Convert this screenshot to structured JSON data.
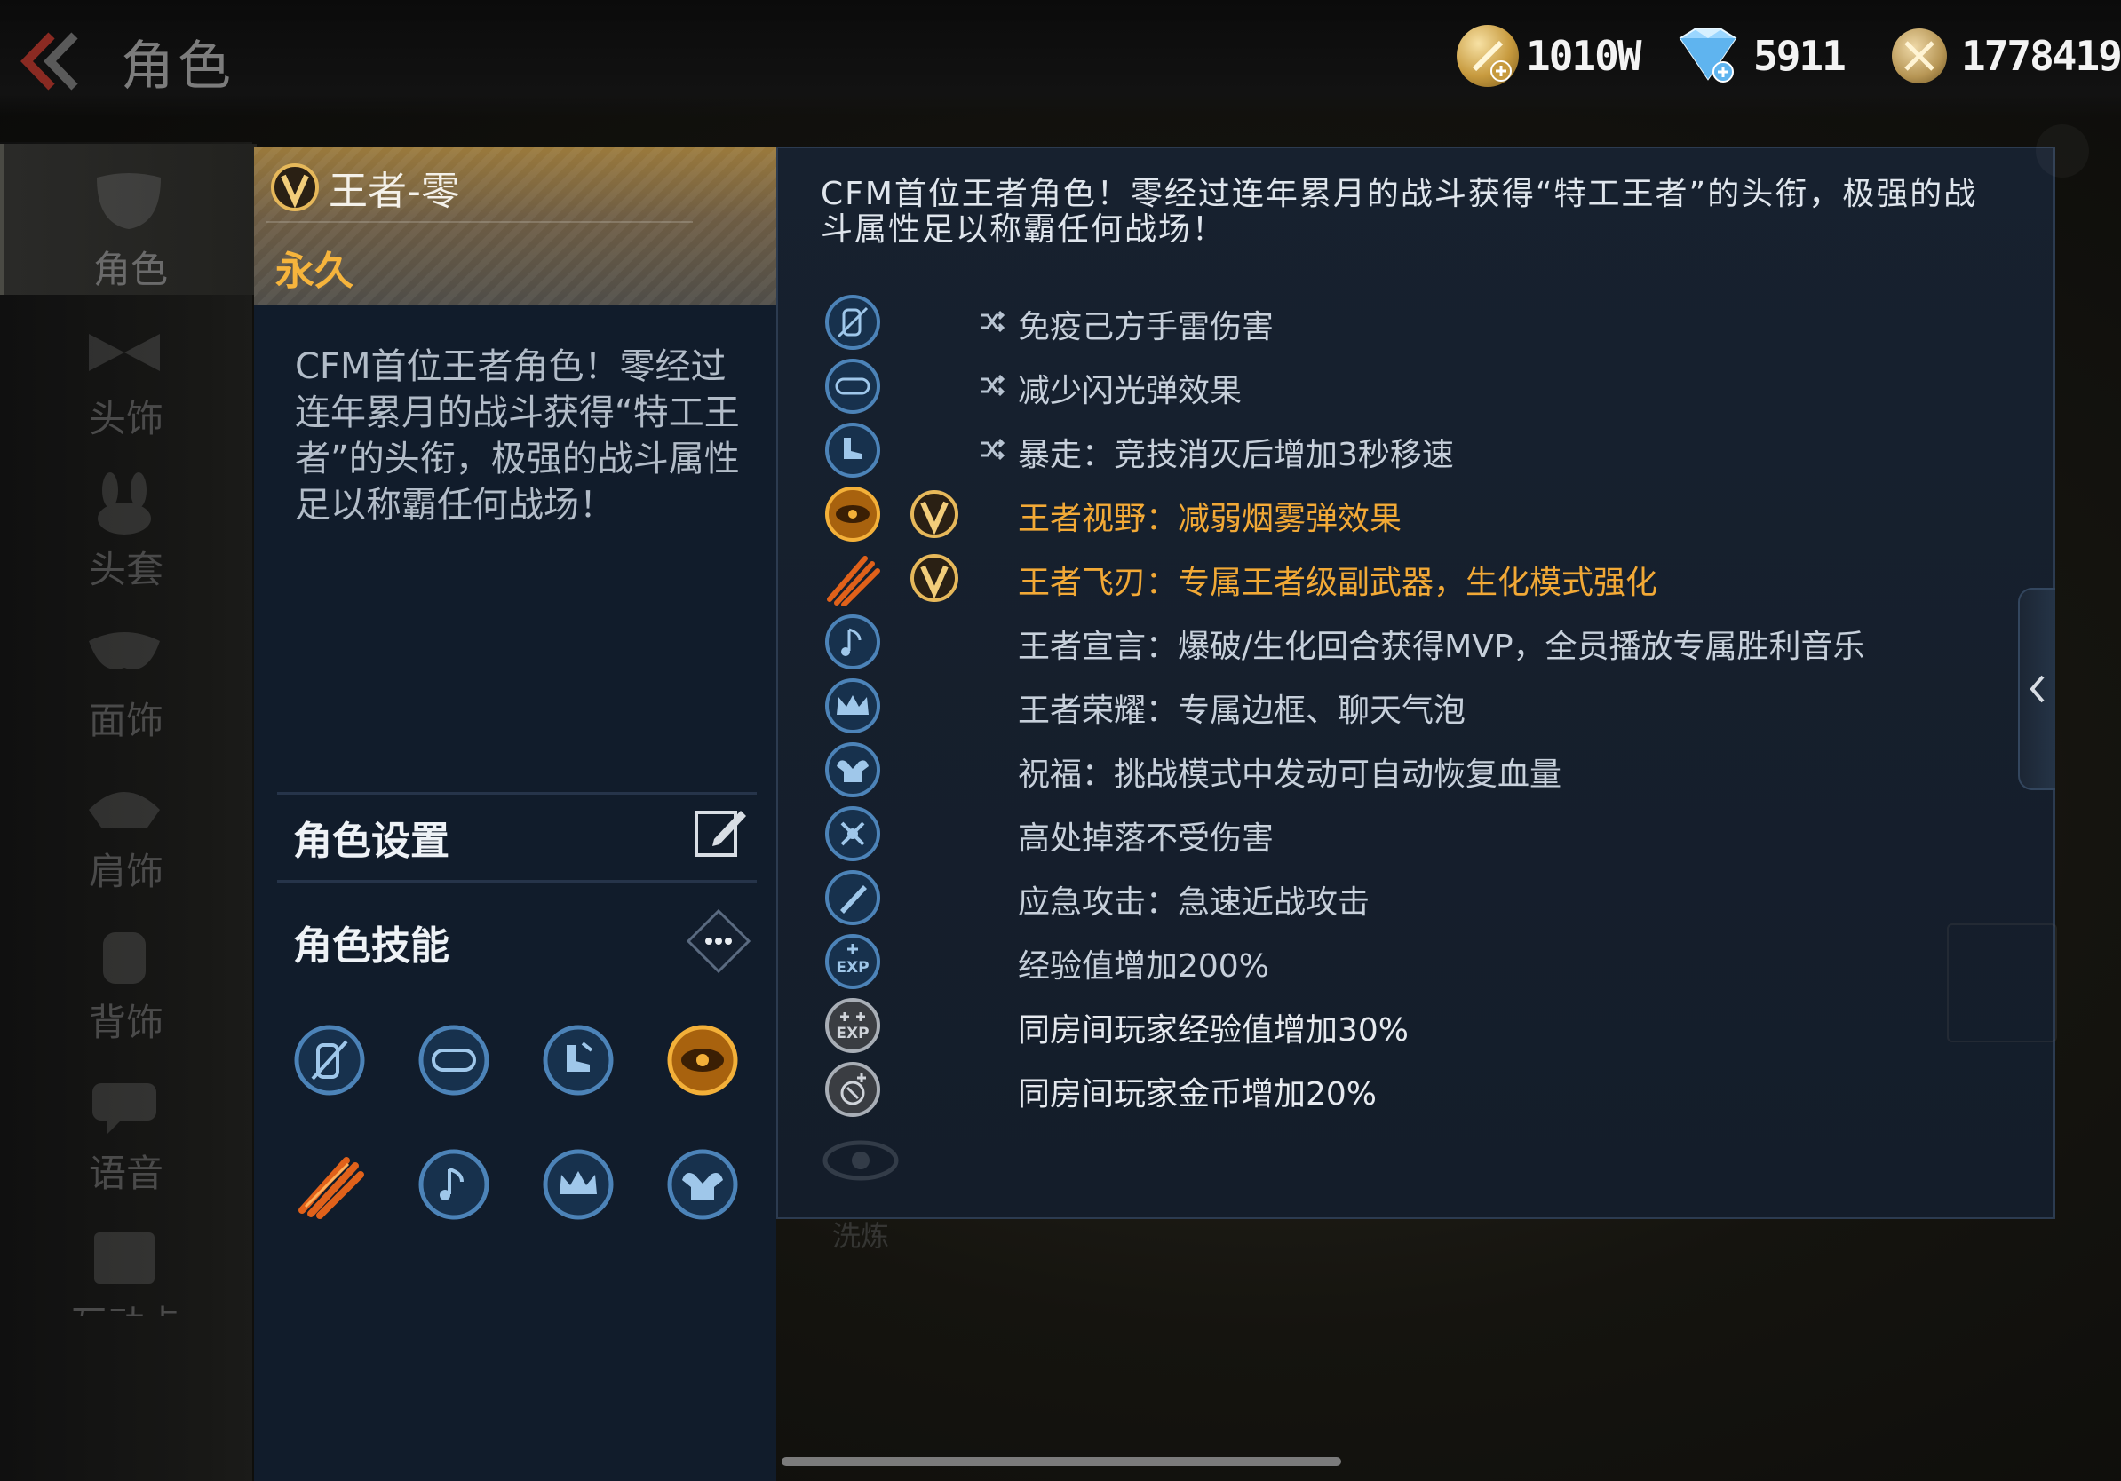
{
  "header": {
    "title": "角色",
    "back_icon": "double-chevron-left-icon",
    "currencies": [
      {
        "icon": "gold-coin-plus-icon",
        "amount": "1010W"
      },
      {
        "icon": "diamond-plus-icon",
        "amount": "5911"
      },
      {
        "icon": "crossed-swords-medal-icon",
        "amount": "1778419"
      }
    ]
  },
  "sidebar": {
    "items": [
      {
        "label": "角色",
        "icon": "mask-icon",
        "active": true
      },
      {
        "label": "头饰",
        "icon": "bow-icon",
        "active": false
      },
      {
        "label": "头套",
        "icon": "bunny-ears-icon",
        "active": false
      },
      {
        "label": "面饰",
        "icon": "face-mask-icon",
        "active": false
      },
      {
        "label": "肩饰",
        "icon": "shoulder-icon",
        "active": false
      },
      {
        "label": "背饰",
        "icon": "backpack-icon",
        "active": false
      },
      {
        "label": "语音",
        "icon": "speech-icon",
        "active": false
      },
      {
        "label": "互动卡",
        "icon": "card-icon",
        "active": false
      }
    ]
  },
  "character": {
    "name": "王者-零",
    "duration": "永久",
    "description": "CFM首位王者角色！零经过连年累月的战斗获得“特工王者”的头衔，极强的战斗属性足以称霸任何战场！",
    "settings_label": "角色设置",
    "skills_label": "角色技能",
    "colors": {
      "gold": "#f6b43c",
      "panel": "#111c2b"
    }
  },
  "skills_panel": {
    "intro": "CFM首位王者角色！零经过连年累月的战斗获得“特工王者”的头衔，极强的战斗属性足以称霸任何战场！",
    "skills": [
      {
        "icon": "grenade-immunity-icon",
        "has_v": false,
        "shuffle": true,
        "gold": false,
        "text": "免疫己方手雷伤害"
      },
      {
        "icon": "goggles-icon",
        "has_v": false,
        "shuffle": true,
        "gold": false,
        "text": "减少闪光弹效果"
      },
      {
        "icon": "boot-speed-icon",
        "has_v": false,
        "shuffle": true,
        "gold": false,
        "text": "暴走：竞技消灭后增加3秒移速"
      },
      {
        "icon": "eye-vision-icon",
        "has_v": true,
        "shuffle": false,
        "gold": true,
        "text": "王者视野：减弱烟雾弹效果"
      },
      {
        "icon": "flying-blade-icon",
        "has_v": true,
        "shuffle": false,
        "gold": true,
        "text": "王者飞刃：专属王者级副武器，生化模式强化"
      },
      {
        "icon": "music-note-icon",
        "has_v": false,
        "shuffle": false,
        "gold": false,
        "text": "王者宣言：爆破/生化回合获得MVP，全员播放专属胜利音乐"
      },
      {
        "icon": "crown-icon",
        "has_v": false,
        "shuffle": false,
        "gold": false,
        "text": "王者荣耀：专属边框、聊天气泡"
      },
      {
        "icon": "muscle-heal-icon",
        "has_v": false,
        "shuffle": false,
        "gold": false,
        "text": "祝福：挑战模式中发动可自动恢复血量"
      },
      {
        "icon": "fall-protection-icon",
        "has_v": false,
        "shuffle": false,
        "gold": false,
        "text": "高处掉落不受伤害"
      },
      {
        "icon": "knife-attack-icon",
        "has_v": false,
        "shuffle": false,
        "gold": false,
        "text": "应急攻击：急速近战攻击"
      },
      {
        "icon": "exp-boost-icon",
        "has_v": false,
        "shuffle": false,
        "gold": false,
        "text": "经验值增加200%"
      },
      {
        "icon": "room-exp-icon",
        "has_v": false,
        "shuffle": false,
        "gold": false,
        "text": "同房间玩家经验值增加30%"
      },
      {
        "icon": "room-coin-icon",
        "has_v": false,
        "shuffle": false,
        "gold": false,
        "text": "同房间玩家金币增加20%"
      }
    ],
    "ghost_label": "洗炼"
  }
}
